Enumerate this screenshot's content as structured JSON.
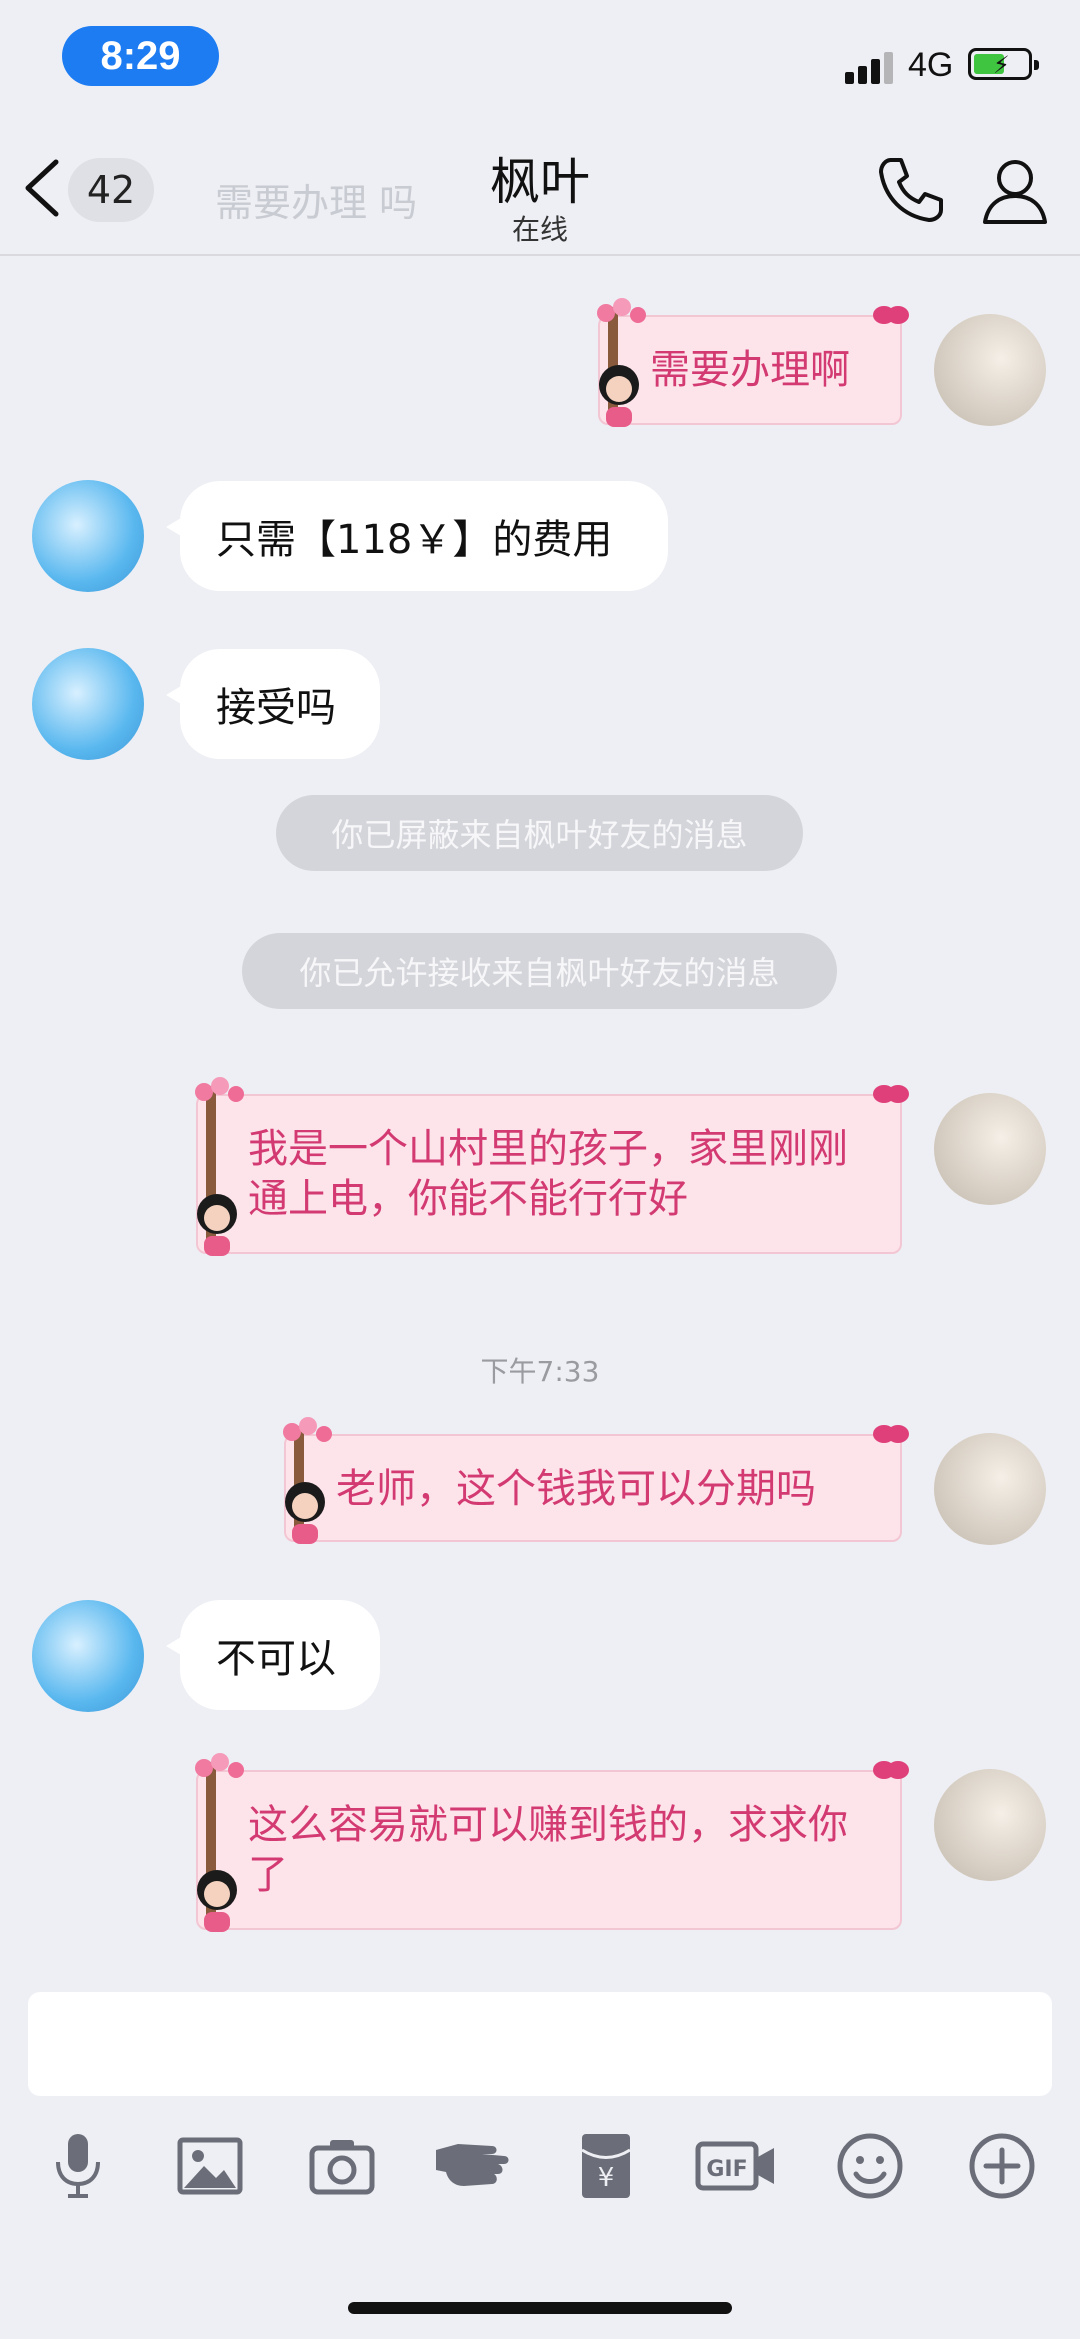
{
  "status_bar": {
    "time": "8:29",
    "network": "4G"
  },
  "header": {
    "back_count": "42",
    "ghost_text": "需要办理 吗",
    "title": "枫叶",
    "subtitle": "在线"
  },
  "messages": [
    {
      "side": "right",
      "style": "pink",
      "text": "需要办理啊"
    },
    {
      "side": "left",
      "style": "white",
      "text": "只需【118￥】的费用"
    },
    {
      "side": "left",
      "style": "white",
      "text": "接受吗"
    },
    {
      "side": "center",
      "style": "notice",
      "text": "你已屏蔽来自枫叶好友的消息"
    },
    {
      "side": "center",
      "style": "notice",
      "text": "你已允许接收来自枫叶好友的消息"
    },
    {
      "side": "right",
      "style": "pink",
      "text": "我是一个山村里的孩子，家里刚刚通上电，你能不能行行好"
    },
    {
      "side": "center",
      "style": "timestamp",
      "text": "下午7:33"
    },
    {
      "side": "right",
      "style": "pink",
      "text": "老师，这个钱我可以分期吗"
    },
    {
      "side": "left",
      "style": "white",
      "text": "不可以"
    },
    {
      "side": "right",
      "style": "pink",
      "text": "这么容易就可以赚到钱的，求求你了"
    }
  ],
  "toolbar": {
    "icons": [
      "microphone-icon",
      "image-icon",
      "camera-icon",
      "poke-hand-icon",
      "red-packet-icon",
      "gif-icon",
      "emoji-icon",
      "plus-icon"
    ],
    "red_packet_symbol": "¥",
    "gif_label": "GIF"
  },
  "colors": {
    "accent": "#1d7cf2",
    "pink_bubble": "#fde3ea",
    "pink_text": "#d23a71",
    "notice_bg": "#d4d5da"
  }
}
